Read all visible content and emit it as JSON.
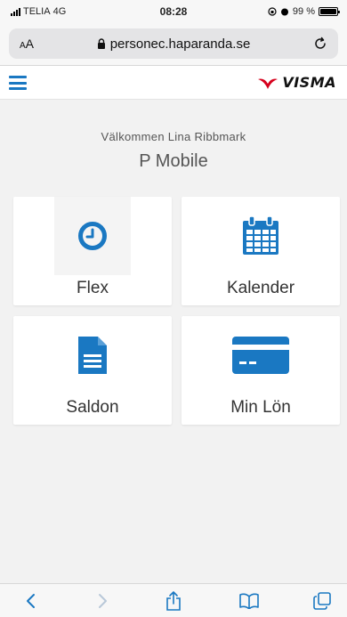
{
  "status_bar": {
    "carrier": "TELIA",
    "network": "4G",
    "time": "08:28",
    "battery": "99 %",
    "battery_level": 0.99
  },
  "browser": {
    "aa_label_small": "A",
    "aa_label_large": "A",
    "url": "personec.haparanda.se"
  },
  "header": {
    "brand": "VISMA",
    "brand_color": "#d6001c",
    "accent_color": "#1a78c2"
  },
  "main": {
    "welcome": "Välkommen Lina Ribbmark",
    "title": "P Mobile",
    "tiles": [
      {
        "label": "Flex",
        "icon": "clock-icon"
      },
      {
        "label": "Kalender",
        "icon": "calendar-icon"
      },
      {
        "label": "Saldon",
        "icon": "document-icon"
      },
      {
        "label": "Min Lön",
        "icon": "credit-card-icon"
      }
    ]
  },
  "toolbar": {
    "icons": [
      "back-icon",
      "forward-icon",
      "share-icon",
      "bookmarks-icon",
      "tabs-icon"
    ]
  }
}
